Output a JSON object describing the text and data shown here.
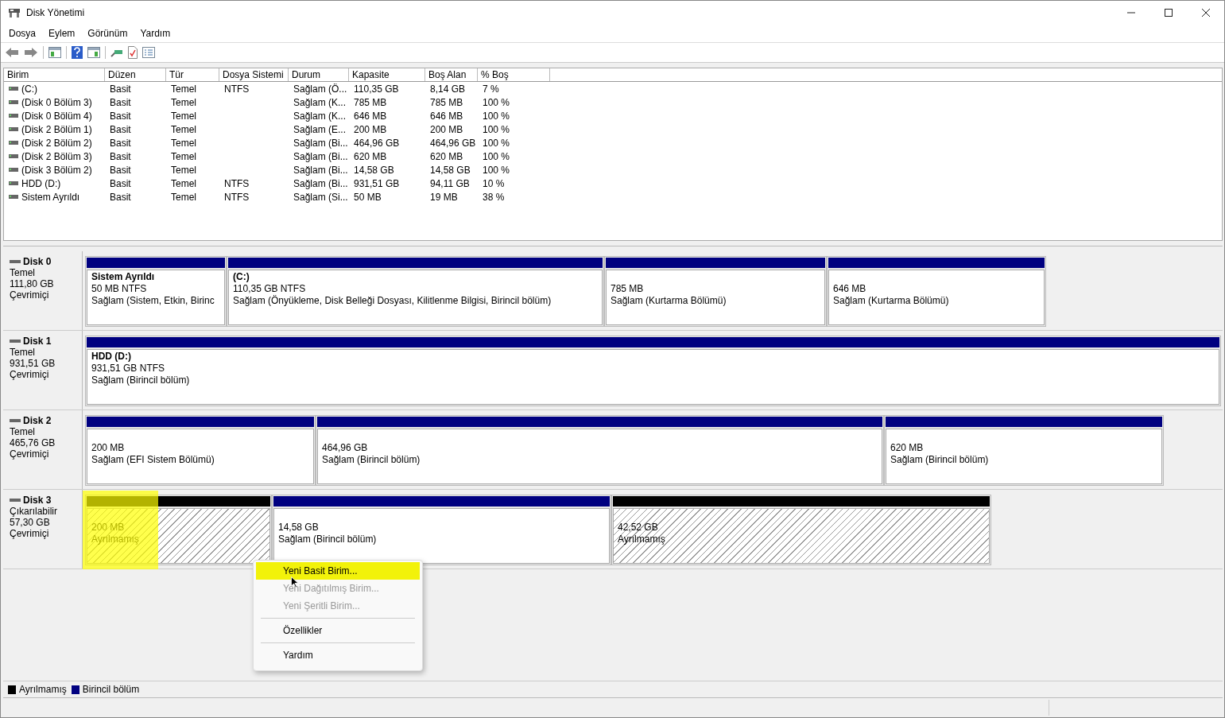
{
  "window": {
    "title": "Disk Yönetimi"
  },
  "menu": [
    "Dosya",
    "Eylem",
    "Görünüm",
    "Yardım"
  ],
  "table": {
    "columns": [
      "Birim",
      "Düzen",
      "Tür",
      "Dosya Sistemi",
      "Durum",
      "Kapasite",
      "Boş Alan",
      "% Boş"
    ],
    "rows": [
      [
        "(C:)",
        "Basit",
        "Temel",
        "NTFS",
        "Sağlam (Ö...",
        "110,35 GB",
        "8,14 GB",
        "7 %"
      ],
      [
        "(Disk 0 Bölüm 3)",
        "Basit",
        "Temel",
        "",
        "Sağlam (K...",
        "785 MB",
        "785 MB",
        "100 %"
      ],
      [
        "(Disk 0 Bölüm 4)",
        "Basit",
        "Temel",
        "",
        "Sağlam (K...",
        "646 MB",
        "646 MB",
        "100 %"
      ],
      [
        "(Disk 2 Bölüm 1)",
        "Basit",
        "Temel",
        "",
        "Sağlam (E...",
        "200 MB",
        "200 MB",
        "100 %"
      ],
      [
        "(Disk 2 Bölüm 2)",
        "Basit",
        "Temel",
        "",
        "Sağlam (Bi...",
        "464,96 GB",
        "464,96 GB",
        "100 %"
      ],
      [
        "(Disk 2 Bölüm 3)",
        "Basit",
        "Temel",
        "",
        "Sağlam (Bi...",
        "620 MB",
        "620 MB",
        "100 %"
      ],
      [
        "(Disk 3 Bölüm 2)",
        "Basit",
        "Temel",
        "",
        "Sağlam (Bi...",
        "14,58 GB",
        "14,58 GB",
        "100 %"
      ],
      [
        "HDD (D:)",
        "Basit",
        "Temel",
        "NTFS",
        "Sağlam (Bi...",
        "931,51 GB",
        "94,11 GB",
        "10 %"
      ],
      [
        "Sistem Ayrıldı",
        "Basit",
        "Temel",
        "NTFS",
        "Sağlam (Si...",
        "50 MB",
        "19 MB",
        "38 %"
      ]
    ]
  },
  "disks": [
    {
      "name": "Disk 0",
      "type": "Temel",
      "size": "111,80 GB",
      "status": "Çevrimiçi",
      "partitions": [
        {
          "kind": "primary",
          "name": "Sistem Ayrıldı",
          "size": "50 MB NTFS",
          "status": "Sağlam (Sistem, Etkin, Birinc",
          "highlighted": false
        },
        {
          "kind": "primary",
          "name": " (C:)",
          "size": "110,35 GB NTFS",
          "status": "Sağlam (Önyükleme, Disk Belleği Dosyası, Kilitlenme Bilgisi, Birincil bölüm)",
          "highlighted": false
        },
        {
          "kind": "primary",
          "size": "785 MB",
          "status": "Sağlam (Kurtarma Bölümü)",
          "highlighted": false
        },
        {
          "kind": "primary",
          "size": "646 MB",
          "status": "Sağlam (Kurtarma Bölümü)",
          "highlighted": false
        }
      ]
    },
    {
      "name": "Disk 1",
      "type": "Temel",
      "size": "931,51 GB",
      "status": "Çevrimiçi",
      "partitions": [
        {
          "kind": "primary",
          "name": "HDD  (D:)",
          "size": "931,51 GB NTFS",
          "status": "Sağlam (Birincil bölüm)",
          "highlighted": false
        }
      ]
    },
    {
      "name": "Disk 2",
      "type": "Temel",
      "size": "465,76 GB",
      "status": "Çevrimiçi",
      "partitions": [
        {
          "kind": "primary",
          "size": "200 MB",
          "status": "Sağlam (EFI Sistem Bölümü)",
          "highlighted": false
        },
        {
          "kind": "primary",
          "size": "464,96 GB",
          "status": "Sağlam (Birincil bölüm)",
          "highlighted": false
        },
        {
          "kind": "primary",
          "size": "620 MB",
          "status": "Sağlam (Birincil bölüm)",
          "highlighted": false
        }
      ]
    },
    {
      "name": "Disk 3",
      "type": "Çıkarılabilir",
      "size": "57,30 GB",
      "status": "Çevrimiçi",
      "partitions": [
        {
          "kind": "unallocated",
          "size": "200 MB",
          "status": "Ayrılmamış",
          "highlighted": true
        },
        {
          "kind": "primary",
          "size": "14,58 GB",
          "status": "Sağlam (Birincil bölüm)",
          "highlighted": false
        },
        {
          "kind": "unallocated",
          "size": "42,52 GB",
          "status": "Ayrılmamış",
          "highlighted": false
        }
      ]
    }
  ],
  "context_menu": [
    {
      "kind": "item",
      "label": "Yeni Basit Birim...",
      "disabled": false,
      "selected": true
    },
    {
      "kind": "item",
      "label": "Yeni Dağıtılmış Birim...",
      "disabled": true,
      "selected": false
    },
    {
      "kind": "item",
      "label": "Yeni Şeritli Birim...",
      "disabled": true,
      "selected": false
    },
    {
      "kind": "separator"
    },
    {
      "kind": "item",
      "label": "Özellikler",
      "disabled": false,
      "selected": false
    },
    {
      "kind": "separator"
    },
    {
      "kind": "item",
      "label": "Yardım",
      "disabled": false,
      "selected": false
    }
  ],
  "legend": [
    {
      "label": "Ayrılmamış",
      "color": "#000000"
    },
    {
      "label": "Birincil bölüm",
      "color": "#000080"
    }
  ]
}
